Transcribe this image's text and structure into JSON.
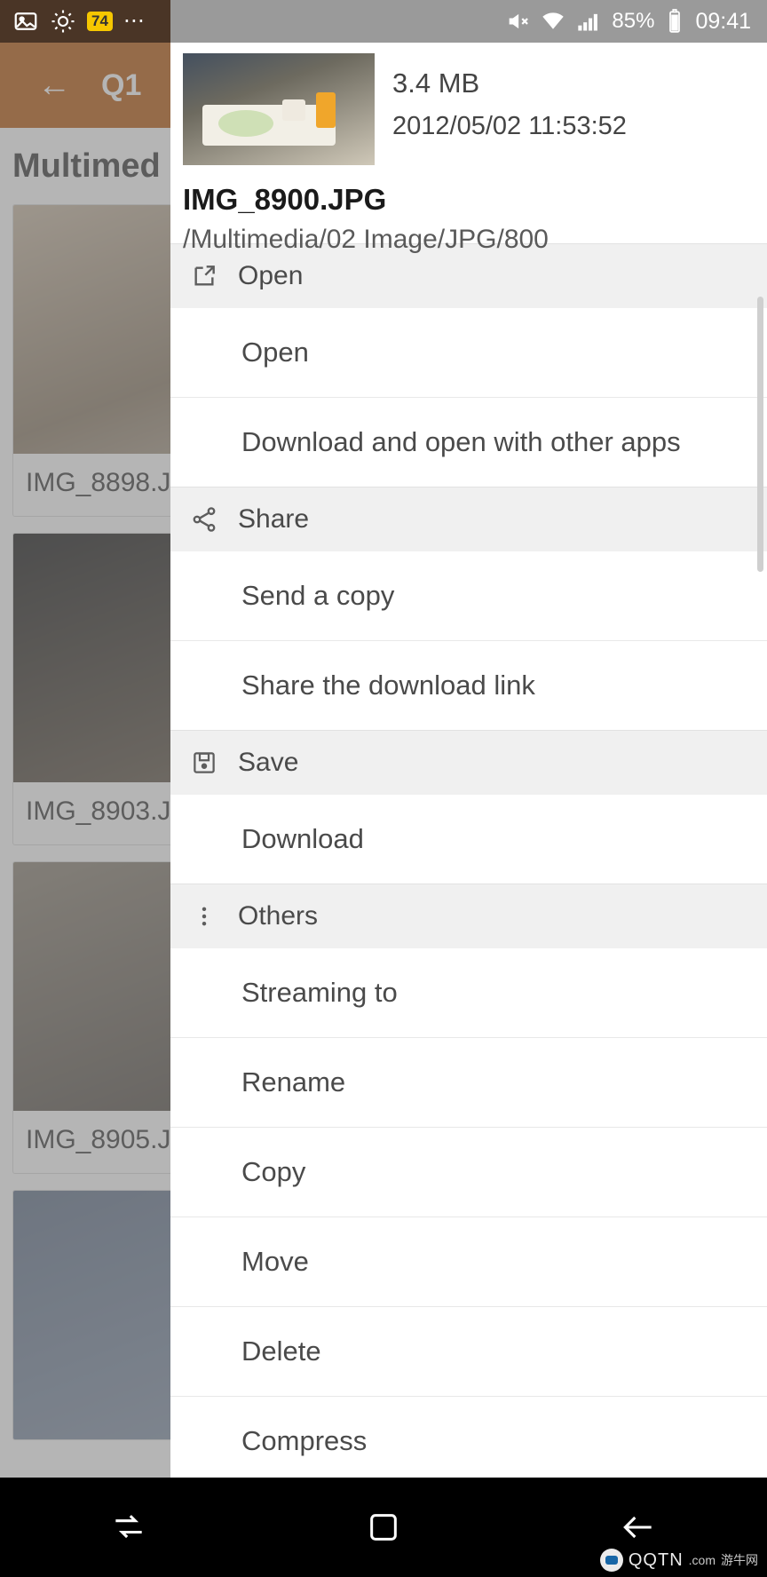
{
  "statusbar": {
    "icons": [
      "image-icon",
      "weather-icon",
      "battery-saver-badge",
      "more-dots"
    ],
    "badge_text": "74",
    "mute_icon": "mute-icon",
    "wifi_icon": "wifi-icon",
    "signal_icon": "signal-icon",
    "battery_percent": "85%",
    "battery_icon": "battery-icon",
    "clock": "09:41"
  },
  "background_app": {
    "back_icon": "back-arrow-icon",
    "appbar_title": "Q1",
    "page_title": "Multimed",
    "cards": [
      {
        "caption": "IMG_8898.J"
      },
      {
        "caption": "IMG_8903.J"
      },
      {
        "caption": "IMG_8905.J"
      },
      {
        "caption": ""
      }
    ]
  },
  "sheet": {
    "file": {
      "thumbnail": "photo-thumbnail",
      "size": "3.4 MB",
      "date": "2012/05/02 11:53:52",
      "name": "IMG_8900.JPG",
      "path": "/Multimedia/02 Image/JPG/800"
    },
    "groups": [
      {
        "header": {
          "label": "Open",
          "icon": "open-external-icon"
        },
        "items": [
          {
            "label": "Open"
          },
          {
            "label": "Download and open with other apps"
          }
        ]
      },
      {
        "header": {
          "label": "Share",
          "icon": "share-icon"
        },
        "items": [
          {
            "label": "Send a copy"
          },
          {
            "label": "Share the download link"
          }
        ]
      },
      {
        "header": {
          "label": "Save",
          "icon": "save-disk-icon"
        },
        "items": [
          {
            "label": "Download"
          }
        ]
      },
      {
        "header": {
          "label": "Others",
          "icon": "more-vertical-icon"
        },
        "items": [
          {
            "label": "Streaming to"
          },
          {
            "label": "Rename"
          },
          {
            "label": "Copy"
          },
          {
            "label": "Move"
          },
          {
            "label": "Delete"
          },
          {
            "label": "Compress"
          }
        ]
      }
    ]
  },
  "navbar": {
    "recents_icon": "recents-icon",
    "home_icon": "home-square-icon",
    "back_icon": "back-arrow-icon"
  },
  "watermark": {
    "text": "QQTN",
    "suffix": ".com",
    "sub": "游牛网"
  },
  "colors": {
    "appbar": "#b85c10",
    "statusbar": "#9a9a9a",
    "section_bg": "#f0f0f0",
    "text": "#4a4a4a"
  }
}
